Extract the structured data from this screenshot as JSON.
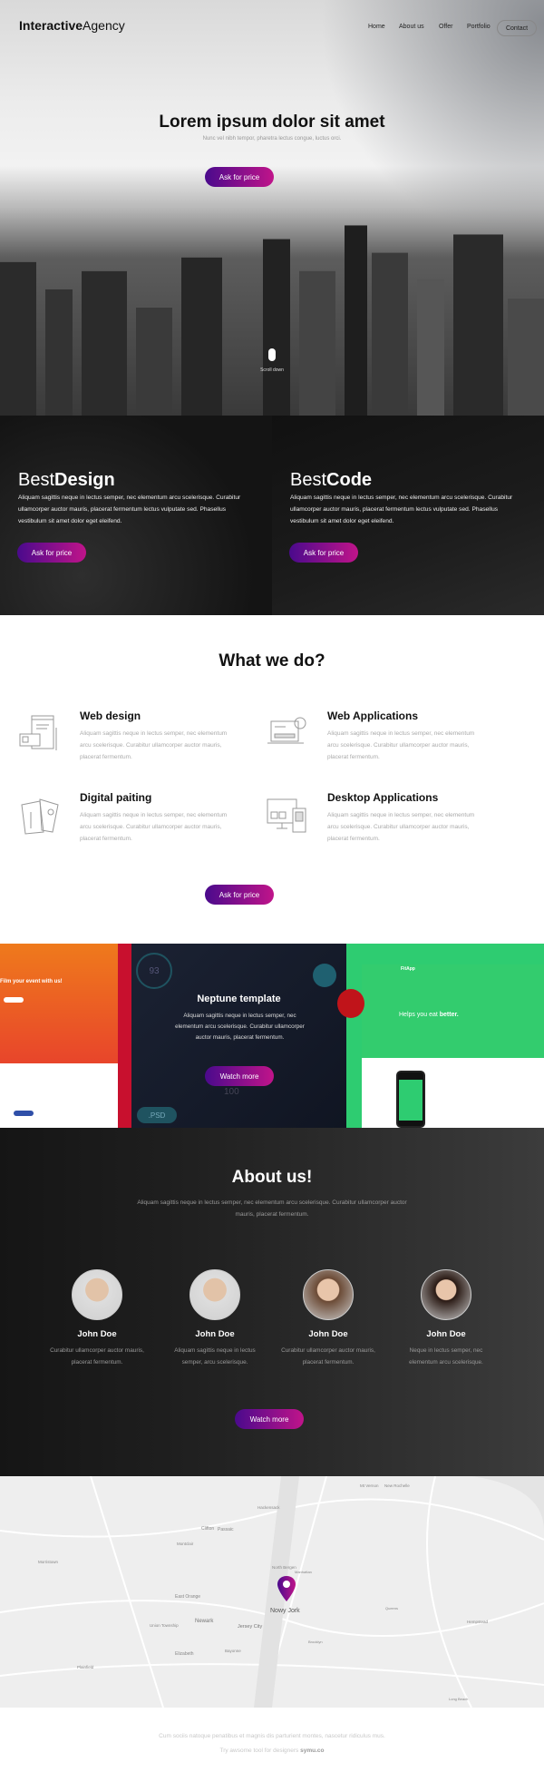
{
  "header": {
    "logo_bold": "Interactive",
    "logo_light": "Agency",
    "nav": [
      "Home",
      "About us",
      "Offer",
      "Portfolio",
      "Contact"
    ]
  },
  "hero": {
    "title": "Lorem ipsum dolor sit amet",
    "subtitle": "Nunc vel nibh tempor, pharetra lectus congue, luctus orci.",
    "button": "Ask for price",
    "scroll_label": "Scroll down"
  },
  "best": [
    {
      "light": "Best",
      "bold": "Design",
      "text": "Aliquam sagittis neque in lectus semper, nec elementum arcu scelerisque. Curabitur ullamcorper auctor mauris, placerat fermentum lectus vulputate sed. Phasellus vestibulum sit amet dolor eget eleifend.",
      "button": "Ask for price"
    },
    {
      "light": "Best",
      "bold": "Code",
      "text": "Aliquam sagittis neque in lectus semper, nec elementum arcu scelerisque. Curabitur ullamcorper auctor mauris, placerat fermentum lectus vulputate sed. Phasellus vestibulum sit amet dolor eget eleifend.",
      "button": "Ask for price"
    }
  ],
  "what": {
    "title": "What we do?",
    "services": [
      {
        "title": "Web design",
        "icon": "web-design-icon",
        "text": "Aliquam sagittis neque in lectus semper, nec elementum arcu scelerisque. Curabitur ullamcorper auctor mauris, placerat fermentum."
      },
      {
        "title": "Web Applications",
        "icon": "web-applications-icon",
        "text": "Aliquam sagittis neque in lectus semper, nec elementum arcu scelerisque. Curabitur ullamcorper auctor mauris, placerat fermentum."
      },
      {
        "title": "Digital paiting",
        "icon": "digital-painting-icon",
        "text": "Aliquam sagittis neque in lectus semper, nec elementum arcu scelerisque. Curabitur ullamcorper auctor mauris, placerat fermentum."
      },
      {
        "title": "Desktop Applications",
        "icon": "desktop-applications-icon",
        "text": "Aliquam sagittis neque in lectus semper, nec elementum arcu scelerisque. Curabitur ullamcorper auctor mauris, placerat fermentum."
      }
    ],
    "button": "Ask for price"
  },
  "portfolio": {
    "left_heading": "Film your event with us!",
    "center_title": "Neptune template",
    "center_text": "Aliquam sagittis neque in lectus semper, nec elementum arcu scelerisque. Curabitur ullamcorper auctor mauris, placerat fermentum.",
    "center_button": "Watch more",
    "center_stat_1": "93",
    "center_stat_2": "100",
    "center_badge": ".PSD",
    "right_brand": "FitApp",
    "right_heading_light": "Helps you eat ",
    "right_heading_bold": "better."
  },
  "about": {
    "title": "About us!",
    "text": "Aliquam sagittis neque in lectus semper, nec elementum arcu scelerisque. Curabitur ullamcorper auctor mauris, placerat fermentum.",
    "members": [
      {
        "name": "John Doe",
        "text": "Curabitur ullamcorper auctor mauris, placerat fermentum."
      },
      {
        "name": "John Doe",
        "text": "Aliquam sagittis neque in lectus semper, arcu scelerisque."
      },
      {
        "name": "John Doe",
        "text": "Curabitur ullamcorper auctor mauris, placerat fermentum."
      },
      {
        "name": "John Doe",
        "text": "Neque in lectus semper, nec elementum arcu scelerisque."
      }
    ],
    "button": "Watch more"
  },
  "map": {
    "pin_label": "Nowy Jork",
    "places": [
      "Newark",
      "Jersey City",
      "East Orange",
      "Clifton",
      "Passaic",
      "Hackensack",
      "North Bergen",
      "Elizabeth",
      "Bayonne",
      "Brooklyn",
      "Manhattan",
      "Queens",
      "Morristown",
      "Plainfield",
      "Mt Vernon",
      "New Rochelle",
      "Hempstead",
      "Long Beach",
      "Montclair",
      "Union Township"
    ]
  },
  "footer": {
    "line1": "Cum sociis natoque penatibus et magnis dis parturient montes, nascetur ridiculus mus.",
    "line2_prefix": "Try awsome tool for designers ",
    "line2_link": "symu.co"
  },
  "colors": {
    "accent_start": "#4a0a8c",
    "accent_end": "#c0148a",
    "fitapp_green": "#2ecc71",
    "orange": "#f0751e"
  }
}
